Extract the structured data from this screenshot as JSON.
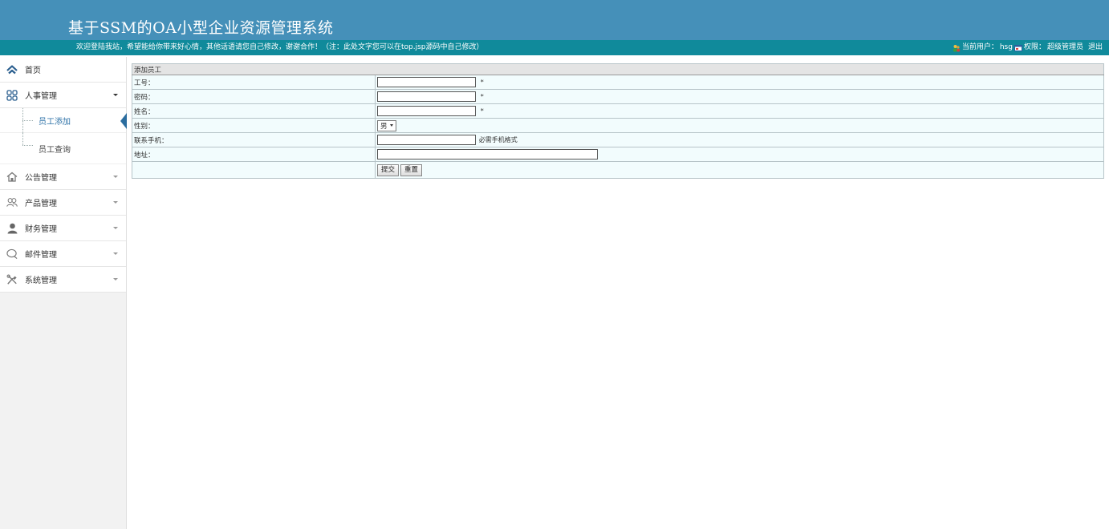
{
  "header": {
    "title": "基于SSM的OA小型企业资源管理系统",
    "welcome": "欢迎登陆我站，希望能给你带来好心情，其他话语请您自己修改，谢谢合作！（注：此处文字您可以在top.jsp源码中自己修改）",
    "current_user_label": "当前用户：",
    "current_user": "hsg",
    "permission_label": "权限：",
    "permission": "超级管理员",
    "logout": "退出"
  },
  "sidebar": {
    "home": "首页",
    "hr": "人事管理",
    "hr_sub": [
      "员工添加",
      "员工查询"
    ],
    "notice": "公告管理",
    "product": "产品管理",
    "finance": "财务管理",
    "mail": "邮件管理",
    "system": "系统管理"
  },
  "form": {
    "caption": "添加员工",
    "fields": {
      "emp_no": {
        "label": "工号：",
        "required_mark": "*"
      },
      "password": {
        "label": "密码：",
        "required_mark": "*"
      },
      "name": {
        "label": "姓名：",
        "required_mark": "*"
      },
      "gender": {
        "label": "性别：",
        "selected": "男"
      },
      "phone": {
        "label": "联系手机：",
        "hint": "必需手机格式"
      },
      "address": {
        "label": "地址："
      }
    },
    "submit_label": "提交",
    "reset_label": "重置"
  },
  "colors": {
    "header_bg": "#4590b9",
    "welcome_bg": "#108a9b",
    "active_accent": "#2b6d9f",
    "row_bg": "#f2fcfd"
  }
}
